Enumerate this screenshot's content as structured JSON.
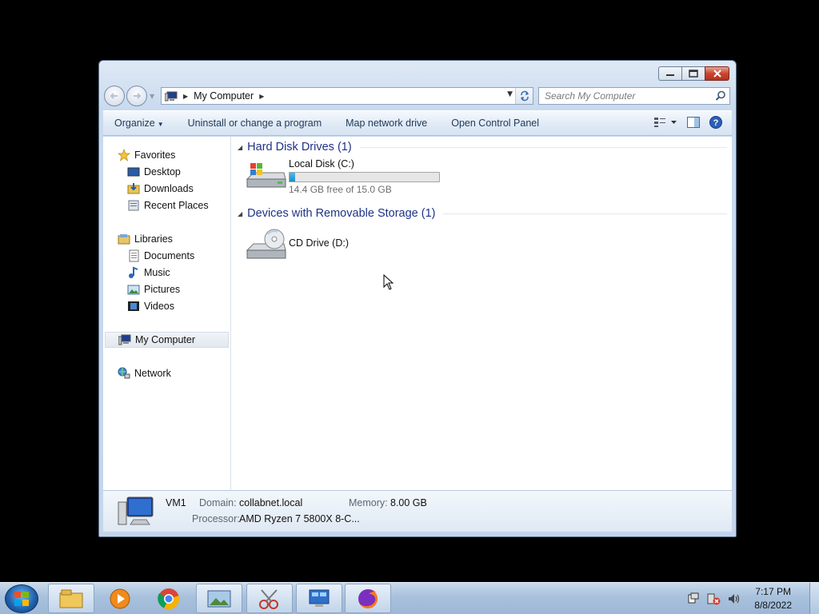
{
  "window": {
    "address": {
      "path": "My Computer"
    },
    "search": {
      "placeholder": "Search My Computer"
    },
    "commands": {
      "organize": "Organize",
      "uninstall": "Uninstall or change a program",
      "map_drive": "Map network drive",
      "control_panel": "Open Control Panel"
    },
    "nav": {
      "favorites": "Favorites",
      "desktop": "Desktop",
      "downloads": "Downloads",
      "recent": "Recent Places",
      "libraries": "Libraries",
      "documents": "Documents",
      "music": "Music",
      "pictures": "Pictures",
      "videos": "Videos",
      "computer": "My Computer",
      "network": "Network"
    },
    "groups": {
      "hdd": "Hard Disk Drives (1)",
      "removable": "Devices with Removable Storage (1)"
    },
    "drives": {
      "c": {
        "name": "Local Disk (C:)",
        "free": "14.4 GB free of 15.0 GB",
        "used_fraction": 0.04
      },
      "d": {
        "name": "CD Drive (D:)"
      }
    },
    "details": {
      "name": "VM1",
      "domain_label": "Domain:",
      "domain_value": "collabnet.local",
      "memory_label": "Memory:",
      "memory_value": "8.00 GB",
      "processor_label": "Processor:",
      "processor_value": "AMD Ryzen 7 5800X 8-C..."
    }
  },
  "taskbar": {
    "time": "7:17 PM",
    "date": "8/8/2022",
    "apps": [
      "windows-explorer",
      "media-player",
      "chrome",
      "photo-viewer",
      "snipping-tool",
      "remote-desktop",
      "firefox"
    ]
  }
}
